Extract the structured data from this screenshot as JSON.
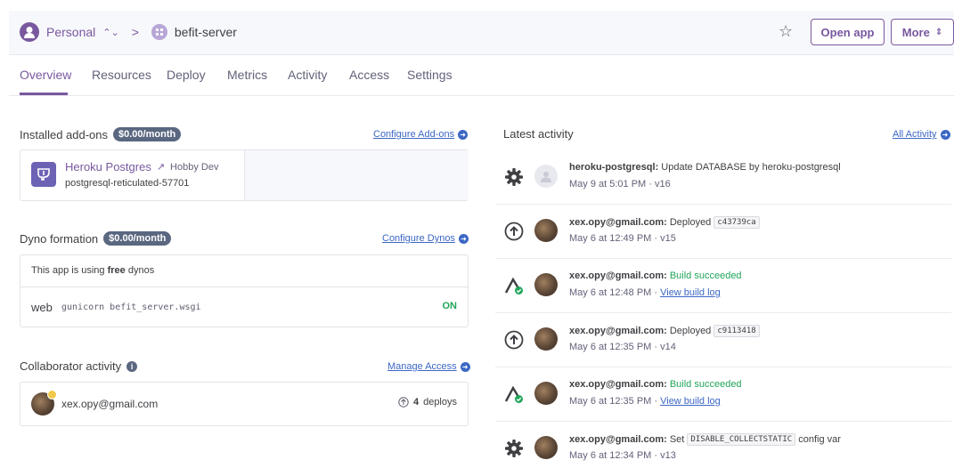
{
  "header": {
    "account_label": "Personal",
    "breadcrumb_sep": ">",
    "app_name": "befit-server",
    "open_app_label": "Open app",
    "more_label": "More"
  },
  "tabs": [
    {
      "label": "Overview",
      "active": true
    },
    {
      "label": "Resources",
      "active": false
    },
    {
      "label": "Deploy",
      "active": false
    },
    {
      "label": "Metrics",
      "active": false
    },
    {
      "label": "Activity",
      "active": false
    },
    {
      "label": "Access",
      "active": false
    },
    {
      "label": "Settings",
      "active": false
    }
  ],
  "addons": {
    "title": "Installed add-ons",
    "price": "$0.00/month",
    "configure_label": "Configure Add-ons",
    "items": [
      {
        "name": "Heroku Postgres",
        "plan": "Hobby Dev",
        "id": "postgresql-reticulated-57701"
      }
    ]
  },
  "dynos": {
    "title": "Dyno formation",
    "price": "$0.00/month",
    "configure_label": "Configure Dynos",
    "free_prefix": "This app is using ",
    "free_word": "free",
    "free_suffix": " dynos",
    "process": {
      "type": "web",
      "command": "gunicorn befit_server.wsgi",
      "state": "ON"
    }
  },
  "collaborators": {
    "title": "Collaborator activity",
    "manage_label": "Manage Access",
    "items": [
      {
        "email": "xex.opy@gmail.com",
        "deploy_count": "4",
        "deploy_word": "deploys"
      }
    ]
  },
  "activity": {
    "title": "Latest activity",
    "all_label": "All Activity",
    "items": [
      {
        "icon": "gear-icon",
        "actor": "heroku-postgresql:",
        "text": "Update DATABASE by heroku-postgresql",
        "time": "May 9 at 5:01 PM",
        "ver": "v16"
      },
      {
        "icon": "deploy-icon",
        "actor": "xex.opy@gmail.com:",
        "text": "Deployed",
        "commit": "c43739ca",
        "time": "May 6 at 12:49 PM",
        "ver": "v15"
      },
      {
        "icon": "build-icon",
        "actor": "xex.opy@gmail.com:",
        "text": "Build succeeded",
        "time": "May 6 at 12:48 PM",
        "link": "View build log"
      },
      {
        "icon": "deploy-icon",
        "actor": "xex.opy@gmail.com:",
        "text": "Deployed",
        "commit": "c9113418",
        "time": "May 6 at 12:35 PM",
        "ver": "v14"
      },
      {
        "icon": "build-icon",
        "actor": "xex.opy@gmail.com:",
        "text": "Build succeeded",
        "time": "May 6 at 12:35 PM",
        "link": "View build log"
      },
      {
        "icon": "gear-icon",
        "actor": "xex.opy@gmail.com:",
        "text_pre": "Set",
        "commit": "DISABLE_COLLECTSTATIC",
        "text_post": "config var",
        "time": "May 6 at 12:34 PM",
        "ver": "v13"
      }
    ]
  },
  "colors": {
    "brand": "#79589f",
    "link": "#3c67c4",
    "success": "#21a55a",
    "pill": "#5a6780"
  }
}
